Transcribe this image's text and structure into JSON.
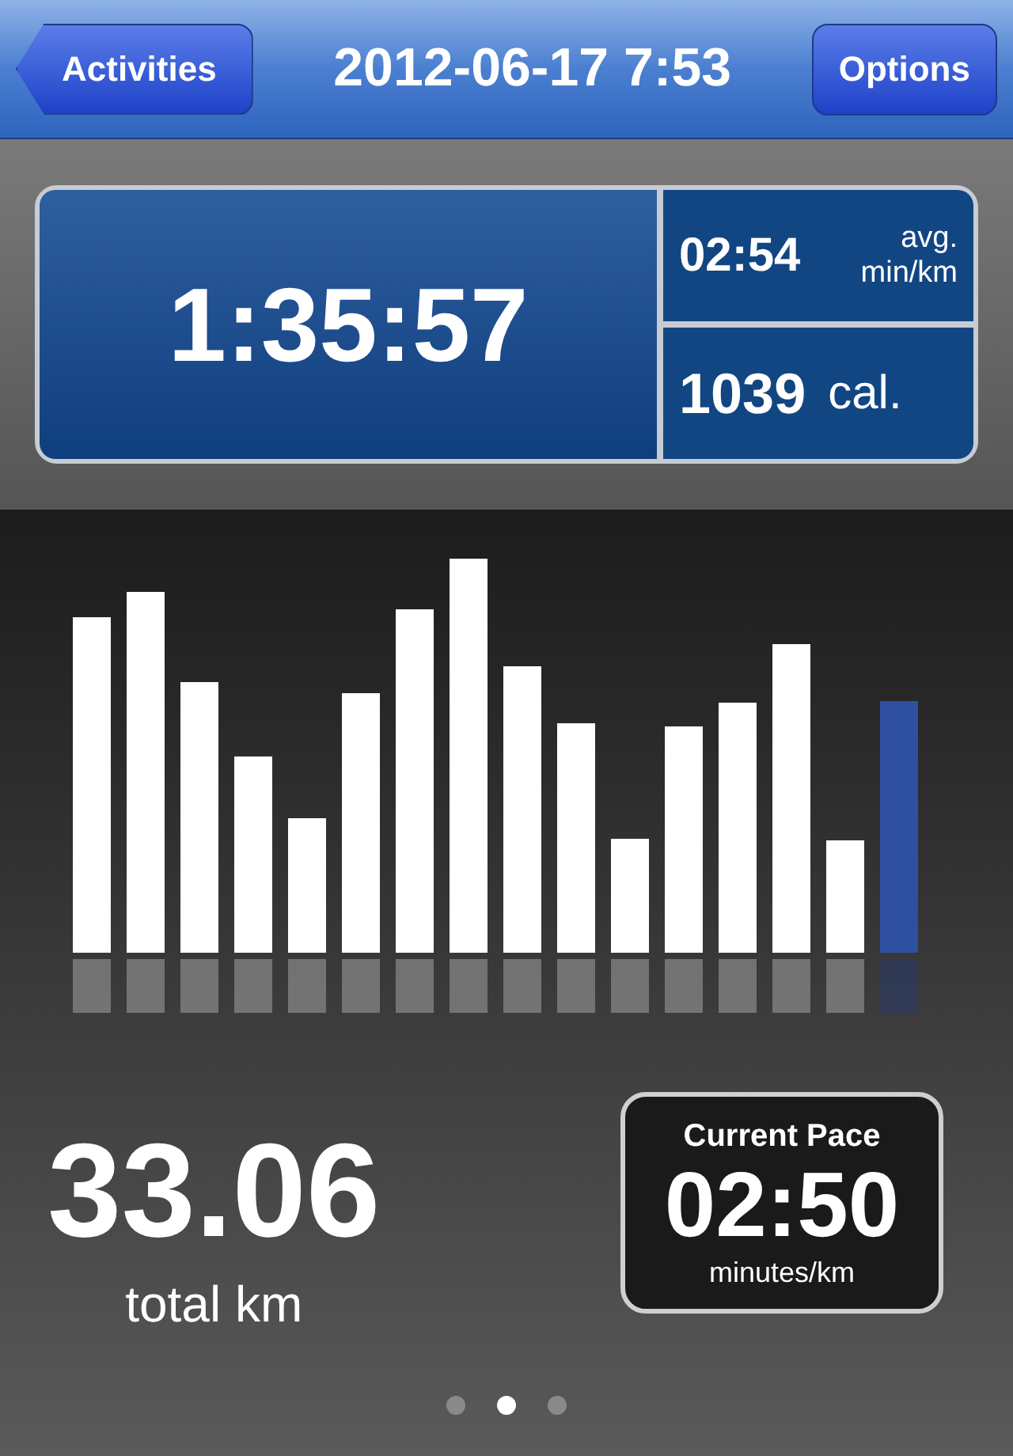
{
  "nav": {
    "back": "Activities",
    "title": "2012-06-17 7:53",
    "options": "Options"
  },
  "stats": {
    "duration": "1:35:57",
    "pace": "02:54",
    "pace_unit_top": "avg.",
    "pace_unit_bottom": "min/km",
    "calories": "1039",
    "calories_unit": "cal."
  },
  "distance": {
    "value": "33.06",
    "unit": "total km"
  },
  "current_pace": {
    "title": "Current Pace",
    "value": "02:50",
    "unit": "minutes/km"
  },
  "page_dots": [
    {
      "selected": false
    },
    {
      "selected": true
    },
    {
      "selected": false
    }
  ]
}
